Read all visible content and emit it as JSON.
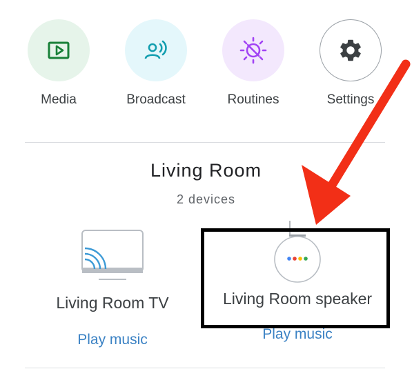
{
  "shortcuts": [
    {
      "label": "Media",
      "icon": "media-icon",
      "bg": "#e6f4ea",
      "color": "#188038"
    },
    {
      "label": "Broadcast",
      "icon": "broadcast-icon",
      "bg": "#e4f7fb",
      "color": "#129eaf"
    },
    {
      "label": "Routines",
      "icon": "routines-icon",
      "bg": "#f3e8fd",
      "color": "#a142f4"
    },
    {
      "label": "Settings",
      "icon": "gear-icon",
      "bg": "#ffffff",
      "color": "#3c4043"
    }
  ],
  "room": {
    "title": "Living Room",
    "subtitle": "2 devices"
  },
  "devices": [
    {
      "name": "Living Room TV",
      "icon": "tv-cast-icon",
      "action": "Play music"
    },
    {
      "name": "Living Room speaker",
      "icon": "speaker-icon",
      "action": "Play music"
    }
  ],
  "annotation": {
    "arrow_color": "#f22f17",
    "box_color": "#000000"
  }
}
